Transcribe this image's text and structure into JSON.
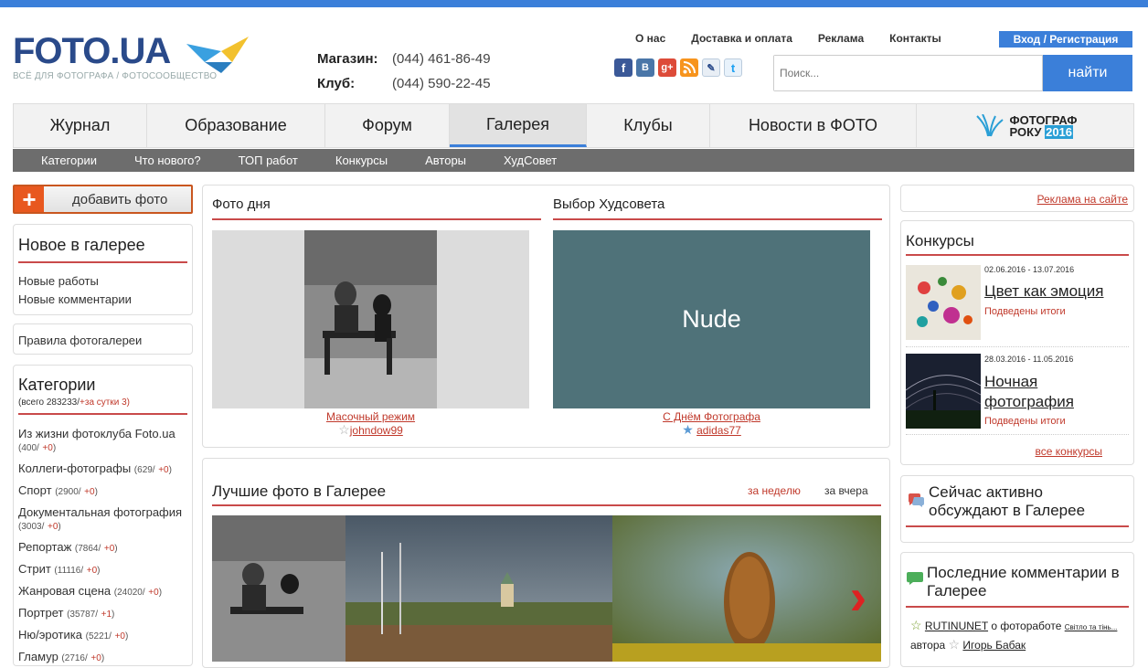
{
  "site": {
    "logo": "FOTO.UA",
    "tagline": "ВСЁ ДЛЯ ФОТОГРАФА / ФОТОСООБЩЕСТВО"
  },
  "contacts": [
    {
      "label": "Магазин:",
      "phone": "(044) 461-86-49"
    },
    {
      "label": "Клуб:",
      "phone": "(044) 590-22-45"
    }
  ],
  "top_links": [
    "О нас",
    "Доставка и оплата",
    "Реклама",
    "Контакты"
  ],
  "login_label": "Вход / Регистрация",
  "search": {
    "placeholder": "Поиск...",
    "button": "найти"
  },
  "socials": [
    "facebook-icon",
    "vkontakte-icon",
    "google-plus-icon",
    "rss-icon",
    "livejournal-icon",
    "twitter-icon"
  ],
  "main_nav": [
    "Журнал",
    "Образование",
    "Форум",
    "Галерея",
    "Клубы",
    "Новости в ФОТО"
  ],
  "main_nav_active": "Галерея",
  "promo": {
    "line1": "ФОТОГРАФ",
    "line2a": "РОКУ",
    "line2b": "2016"
  },
  "sub_nav": [
    "Категории",
    "Что нового?",
    "ТОП работ",
    "Конкурсы",
    "Авторы",
    "ХудСовет"
  ],
  "add_photo": "добавить фото",
  "new_in_gallery": {
    "title": "Новое в галерее",
    "links": [
      "Новые работы",
      "Новые комментарии"
    ]
  },
  "rules": "Правила фотогалереи",
  "categories": {
    "title": "Категории",
    "total": "(всего 283233/",
    "today": "+за сутки 3)",
    "items": [
      {
        "name": "Из жизни фотоклуба Foto.ua",
        "count": "(400/",
        "plus": "+0",
        "tail": ")"
      },
      {
        "name": "Коллеги-фотографы",
        "count": "(629/",
        "plus": "+0",
        "tail": ")"
      },
      {
        "name": "Спорт",
        "count": "(2900/",
        "plus": "+0",
        "tail": ")"
      },
      {
        "name": "Документальная фотография",
        "count": "(3003/",
        "plus": "+0",
        "tail": ")"
      },
      {
        "name": "Репортаж",
        "count": "(7864/",
        "plus": "+0",
        "tail": ")"
      },
      {
        "name": "Стрит",
        "count": "(11116/",
        "plus": "+0",
        "tail": ")"
      },
      {
        "name": "Жанровая сцена",
        "count": "(24020/",
        "plus": "+0",
        "tail": ")"
      },
      {
        "name": "Портрет",
        "count": "(35787/",
        "plus": "+1",
        "tail": ")"
      },
      {
        "name": "Ню/эротика",
        "count": "(5221/",
        "plus": "+0",
        "tail": ")"
      },
      {
        "name": "Гламур",
        "count": "(2716/",
        "plus": "+0",
        "tail": ")"
      }
    ]
  },
  "photo_of_day": {
    "title": "Фото дня",
    "caption": "Масочный режим",
    "author": "johndow99"
  },
  "hudsovet": {
    "title": "Выбор Худсовета",
    "label": "Nude",
    "caption": "С Днём Фотографа",
    "author": "adidas77"
  },
  "best": {
    "title": "Лучшие фото в Галерее",
    "tabs": [
      "за неделю",
      "за вчера"
    ]
  },
  "ads_link": "Реклама на сайте",
  "contests": {
    "title": "Конкурсы",
    "items": [
      {
        "dates": "02.06.2016 - 13.07.2016",
        "name": "Цвет как эмоция",
        "status": "Подведены итоги"
      },
      {
        "dates": "28.03.2016 - 11.05.2016",
        "name": "Ночная фотография",
        "status": "Подведены итоги"
      }
    ],
    "all": "все конкурсы"
  },
  "active": {
    "title": "Сейчас активно обсуждают в Галерее"
  },
  "last_comments": {
    "title": "Последние комментарии в Галерее",
    "user": "RUTINUNET",
    "mid": "о фотоработе",
    "work": "Світло та тінь...",
    "by": "автора",
    "author": "Игорь Бабак"
  },
  "colors": {
    "accent": "#3b7fd9",
    "red": "#c0392b",
    "orange": "#e8581f"
  }
}
